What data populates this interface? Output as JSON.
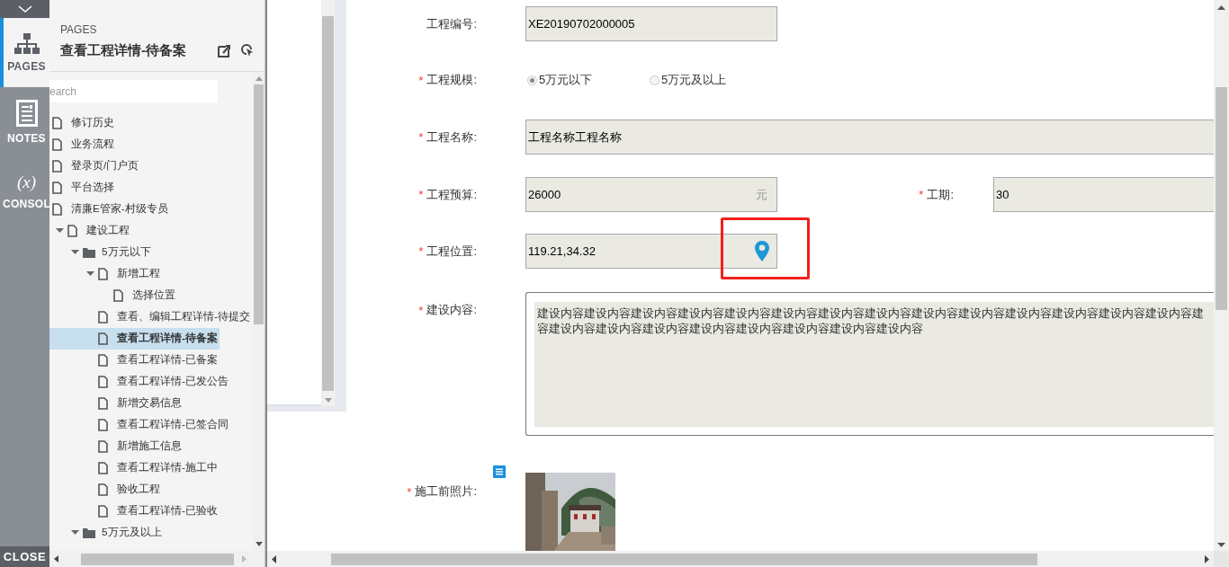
{
  "rail": {
    "tabs": [
      {
        "kind": "pages",
        "label": "PAGES",
        "selected": true
      },
      {
        "kind": "notes",
        "label": "NOTES",
        "selected": false
      },
      {
        "kind": "console",
        "glyph": "(x)",
        "label": "CONSOL",
        "selected": false
      }
    ],
    "close": "CLOSE"
  },
  "pages_panel": {
    "heading": "PAGES",
    "title": "查看工程详情-待备案",
    "search": {
      "placeholder": "earch"
    },
    "tree": [
      {
        "kind": "page",
        "label": "修订历史",
        "selected": false
      },
      {
        "kind": "page",
        "label": "业务流程",
        "selected": false
      },
      {
        "kind": "page",
        "label": "登录页/门户页",
        "selected": false
      },
      {
        "kind": "page",
        "label": "平台选择",
        "selected": false
      },
      {
        "kind": "page",
        "label": "清廉E管家-村级专员",
        "selected": false
      },
      {
        "kind": "page",
        "label": "建设工程",
        "selected": false,
        "expanded": true,
        "children": [
          {
            "kind": "folder",
            "label": "5万元以下",
            "selected": false,
            "expanded": true,
            "children": [
              {
                "kind": "page",
                "label": "新增工程",
                "selected": false,
                "expanded": true,
                "children": [
                  {
                    "kind": "page",
                    "label": "选择位置",
                    "selected": false
                  }
                ]
              },
              {
                "kind": "page",
                "label": "查看、编辑工程详情-待提交",
                "selected": false
              },
              {
                "kind": "page",
                "label": "查看工程详情-待备案",
                "selected": true
              },
              {
                "kind": "page",
                "label": "查看工程详情-已备案",
                "selected": false
              },
              {
                "kind": "page",
                "label": "查看工程详情-已发公告",
                "selected": false
              },
              {
                "kind": "page",
                "label": "新增交易信息",
                "selected": false
              },
              {
                "kind": "page",
                "label": "查看工程详情-已签合同",
                "selected": false
              },
              {
                "kind": "page",
                "label": "新增施工信息",
                "selected": false
              },
              {
                "kind": "page",
                "label": "查看工程详情-施工中",
                "selected": false
              },
              {
                "kind": "page",
                "label": "验收工程",
                "selected": false
              },
              {
                "kind": "page",
                "label": "查看工程详情-已验收",
                "selected": false
              }
            ]
          },
          {
            "kind": "folder",
            "label": "5万元及以上",
            "selected": false,
            "expanded": true
          }
        ]
      }
    ]
  },
  "form": {
    "rows": [
      {
        "fields": [
          {
            "kind": "short_text",
            "label": "工程编号:",
            "value": "XE20190702000005"
          }
        ]
      },
      {
        "fields": [
          {
            "kind": "radio",
            "required_mark": "*",
            "label": "工程规模:",
            "options": [
              {
                "label": "5万元以下",
                "selected": true
              },
              {
                "label": "5万元及以上",
                "selected": false
              }
            ]
          }
        ]
      },
      {
        "fields": [
          {
            "kind": "long_text",
            "required_mark": "*",
            "label": "工程名称:",
            "value": "工程名称工程名称"
          }
        ]
      },
      {
        "fields": [
          {
            "kind": "short_text",
            "required_mark": "*",
            "label": "工程预算:",
            "value": "26000",
            "suffix": "元"
          },
          {
            "kind": "long_text",
            "required_mark": "*",
            "label": "工期:",
            "value": "30"
          }
        ]
      },
      {
        "fields": [
          {
            "kind": "location",
            "required_mark": "*",
            "label": "工程位置:",
            "value": "119.21,34.32",
            "highlighted": true
          }
        ]
      },
      {
        "fields": [
          {
            "kind": "textarea",
            "required_mark": "*",
            "label": "建设内容:",
            "lines": [
              "建设内容建设内容建设内容建设内容建设内容建设内容建设内容建设内容建设内容建设内容建设内容建设内容建设内容建设内容建",
              "容建设内容建设内容建设内容建设内容建设内容建设内容建设内容建设内容"
            ]
          }
        ]
      },
      {
        "fields": [
          {
            "required_mark": "*",
            "label": "施工前照片:"
          }
        ]
      }
    ]
  }
}
